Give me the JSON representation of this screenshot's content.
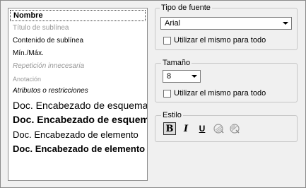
{
  "style_list": {
    "items": [
      {
        "label": "Nombre"
      },
      {
        "label": "Título de sublínea"
      },
      {
        "label": "Contenido de sublínea"
      },
      {
        "label": "Mín./Máx."
      },
      {
        "label": "Repetición innecesaria"
      },
      {
        "label": "Anotación"
      },
      {
        "label": "Atributos o restricciones"
      },
      {
        "label": "Doc. Encabezado de esquema"
      },
      {
        "label": "Doc. Encabezado de esquema"
      },
      {
        "label": "Doc. Encabezado de elemento"
      },
      {
        "label": "Doc. Encabezado de elemento"
      }
    ]
  },
  "font_type": {
    "title": "Tipo de fuente",
    "value": "Arial",
    "same_for_all_label": "Utilizar el mismo para todo"
  },
  "size": {
    "title": "Tamaño",
    "value": "8",
    "same_for_all_label": "Utilizar el mismo para todo"
  },
  "style": {
    "title": "Estilo",
    "bold": "B",
    "italic": "I",
    "underline": "U"
  }
}
